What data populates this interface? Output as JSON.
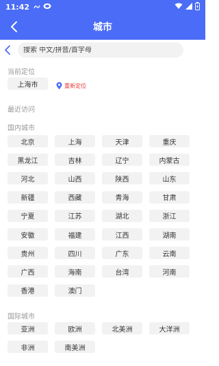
{
  "status_bar": {
    "time": "11:42"
  },
  "header": {
    "title": "城市"
  },
  "search": {
    "placeholder": "搜索 中文/拼音/首字母"
  },
  "current_location": {
    "title": "当前定位",
    "city": "上海市",
    "relocate_label": "重新定位"
  },
  "recent": {
    "title": "最近访问"
  },
  "domestic": {
    "title": "国内城市",
    "cities": [
      "北京",
      "上海",
      "天津",
      "重庆",
      "黑龙江",
      "吉林",
      "辽宁",
      "内蒙古",
      "河北",
      "山西",
      "陕西",
      "山东",
      "新疆",
      "西藏",
      "青海",
      "甘肃",
      "宁夏",
      "江苏",
      "湖北",
      "浙江",
      "安徽",
      "福建",
      "江西",
      "湖南",
      "贵州",
      "四川",
      "广东",
      "云南",
      "广西",
      "海南",
      "台湾",
      "河南",
      "香港",
      "澳门"
    ]
  },
  "international": {
    "title": "国际城市",
    "cities": [
      "亚洲",
      "欧洲",
      "北美洲",
      "大洋洲",
      "非洲",
      "南美洲"
    ]
  },
  "colors": {
    "accent": "#4a6cf7",
    "chip_bg": "#f2f2f2",
    "relocate": "#e53935"
  }
}
